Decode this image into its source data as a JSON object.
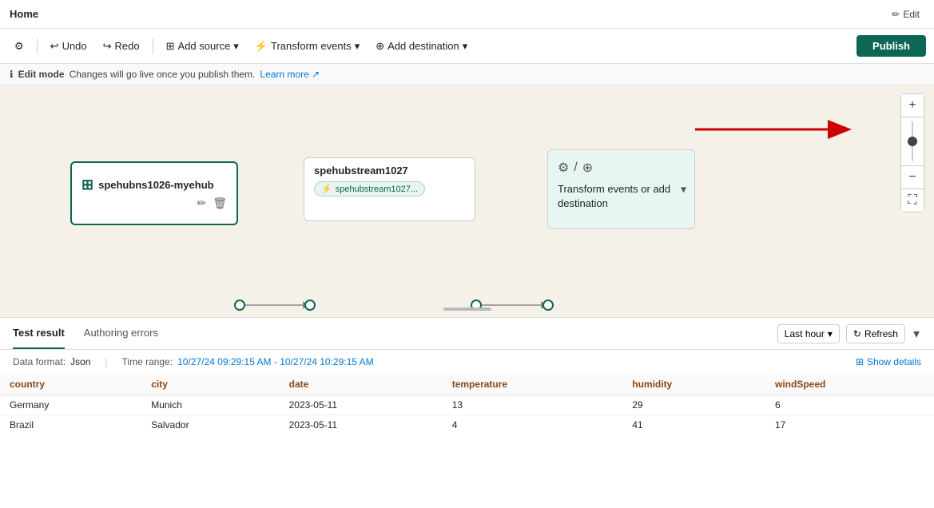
{
  "titleBar": {
    "title": "Home",
    "editLabel": "Edit"
  },
  "toolbar": {
    "undoLabel": "Undo",
    "redoLabel": "Redo",
    "addSourceLabel": "Add source",
    "transformEventsLabel": "Transform events",
    "addDestinationLabel": "Add destination",
    "publishLabel": "Publish",
    "settingsIcon": "⚙",
    "undoIcon": "↩",
    "redoIcon": "↪",
    "addSourceIcon": "⊞",
    "transformIcon": "⚡",
    "addDestIcon": "⊕",
    "dropdownIcon": "▾"
  },
  "infoBar": {
    "mode": "Edit mode",
    "message": "Changes will go live once you publish them.",
    "learnMoreLabel": "Learn more",
    "infoIcon": "ℹ"
  },
  "canvas": {
    "sourceNode": {
      "name": "spehubns1026-myehub",
      "icon": "⊞"
    },
    "streamNode": {
      "name": "spehubstream1027",
      "tagName": "spehubstream1027..."
    },
    "destinationNode": {
      "text": "Transform events or add destination",
      "icons": "⚙ / ⊕",
      "chevronIcon": "▾"
    },
    "plusIcon": "+",
    "minusIcon": "−",
    "expandIcon": "⛶"
  },
  "bottomPanel": {
    "tabs": [
      {
        "label": "Test result",
        "active": true
      },
      {
        "label": "Authoring errors",
        "active": false
      }
    ],
    "lastHourLabel": "Last hour",
    "refreshLabel": "Refresh",
    "refreshIcon": "↻",
    "expandIcon": "▾",
    "dataInfo": {
      "formatLabel": "Data format:",
      "formatValue": "Json",
      "timeRangeLabel": "Time range:",
      "timeRangeValue": "10/27/24 09:29:15 AM - 10/27/24 10:29:15 AM"
    },
    "showDetailsLabel": "Show details",
    "showDetailsIcon": "⊞",
    "table": {
      "columns": [
        "country",
        "city",
        "date",
        "temperature",
        "humidity",
        "windSpeed"
      ],
      "rows": [
        [
          "Germany",
          "Munich",
          "2023-05-11",
          "13",
          "29",
          "6"
        ],
        [
          "Brazil",
          "Salvador",
          "2023-05-11",
          "4",
          "41",
          "17"
        ]
      ]
    }
  }
}
